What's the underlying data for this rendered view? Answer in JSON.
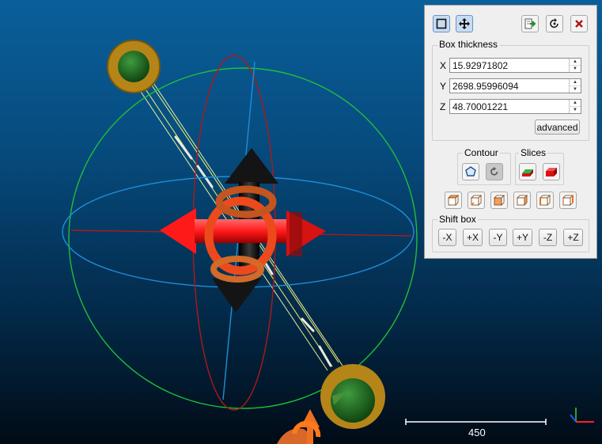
{
  "panel": {
    "box_thickness": {
      "title": "Box thickness",
      "fields": [
        {
          "axis": "X",
          "value": "15.92971802"
        },
        {
          "axis": "Y",
          "value": "2698.95996094"
        },
        {
          "axis": "Z",
          "value": "48.70001221"
        }
      ],
      "advanced_label": "advanced"
    },
    "contour": {
      "title": "Contour"
    },
    "slices": {
      "title": "Slices"
    },
    "shift_box": {
      "title": "Shift box",
      "buttons": [
        "-X",
        "+X",
        "-Y",
        "+Y",
        "-Z",
        "+Z"
      ]
    }
  },
  "scale_bar": {
    "label": "450"
  },
  "colors": {
    "panel_bg": "#efefef",
    "active_tool": "#c8dcf2",
    "sphere_green": "#1fbf3a",
    "ring_red": "#b01818",
    "ring_blue": "#1e8fd8",
    "arrow_red": "#ff1a1a",
    "arrow_black": "#111111",
    "torus_orange": "#e0562a",
    "handle_gold": "#b58518",
    "handle_green": "#1d6b1d",
    "outline_yellow": "#f4f467"
  },
  "icons": {
    "toolbar": [
      "select-box-icon",
      "move-icon",
      "export-icon",
      "reset-icon",
      "close-icon"
    ],
    "contour": [
      "contour-extract-icon",
      "contour-repeat-icon"
    ],
    "slices": [
      "slice-extract-icon",
      "slice-repeat-icon"
    ],
    "views": [
      "view-top-icon",
      "view-bottom-icon",
      "view-front-icon",
      "view-back-icon",
      "view-left-icon",
      "view-right-icon"
    ]
  }
}
